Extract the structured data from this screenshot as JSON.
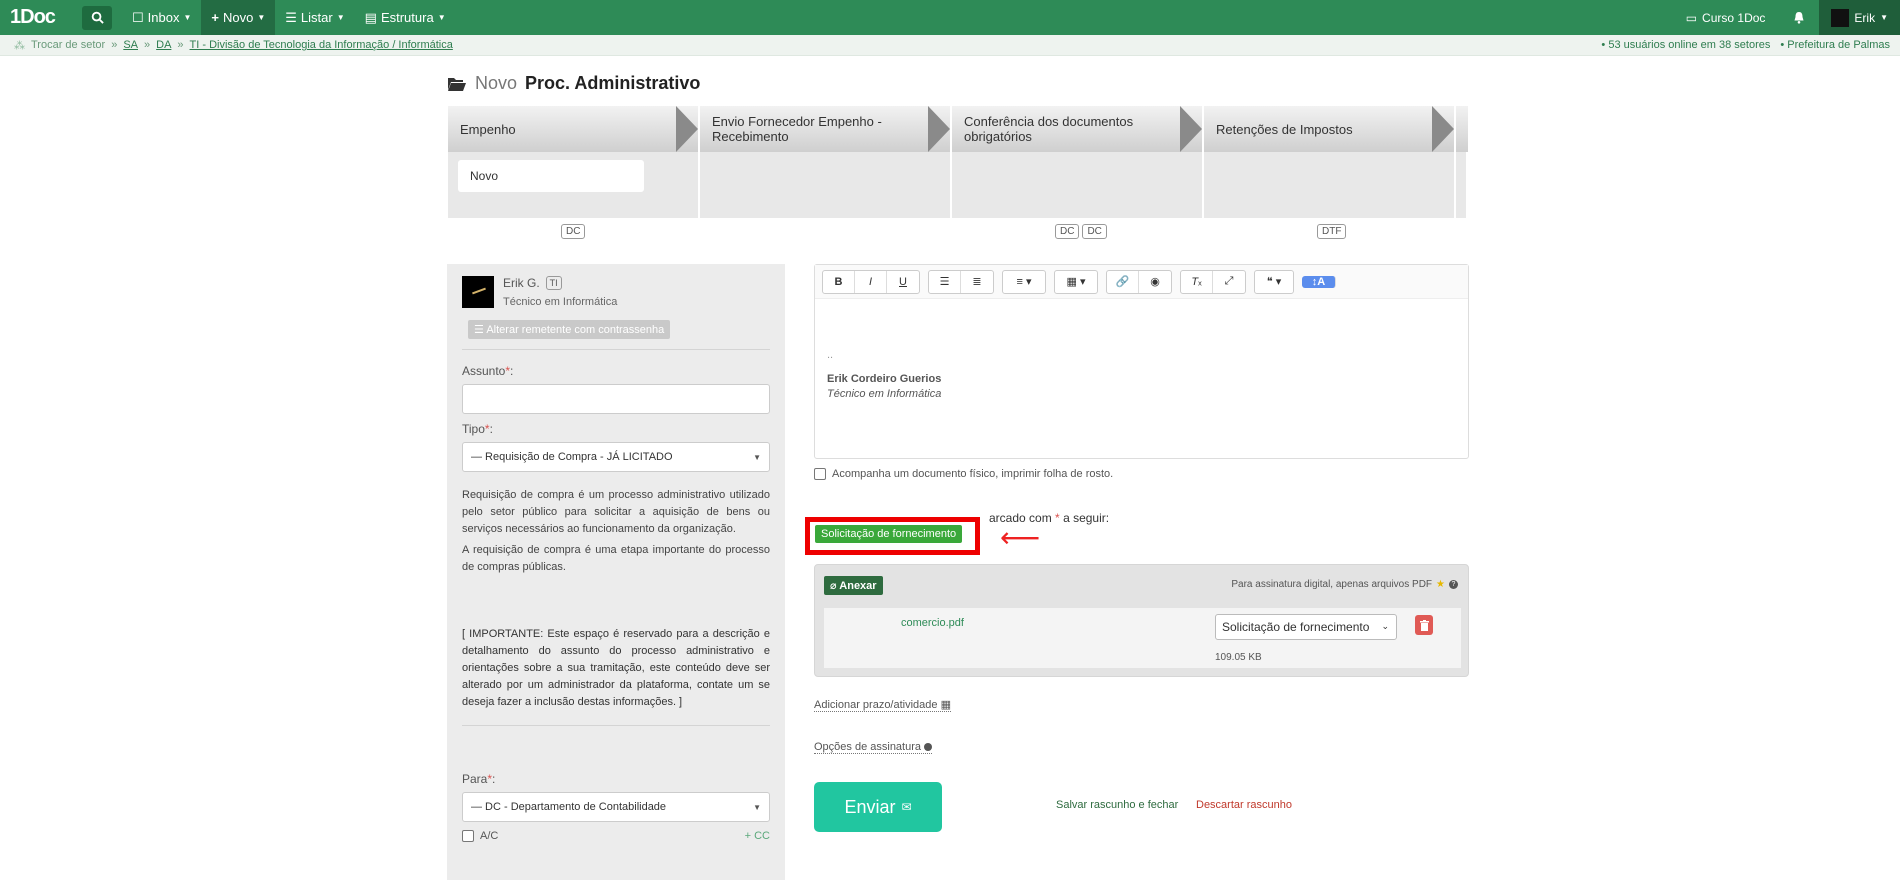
{
  "topbar": {
    "logo": "1Doc",
    "menu": [
      {
        "label": "Inbox",
        "icon": "inbox-icon"
      },
      {
        "label": "Novo",
        "icon": "plus-icon"
      },
      {
        "label": "Listar",
        "icon": "list-icon"
      },
      {
        "label": "Estrutura",
        "icon": "building-icon"
      }
    ],
    "course": "Curso 1Doc",
    "user": "Erik"
  },
  "subbar": {
    "change_sector": "Trocar de setor",
    "breadcrumb": [
      "SA",
      "DA",
      "TI - Divisão de Tecnologia da Informação / Informática"
    ],
    "users_online": "• 53 usuários online em 38 setores",
    "org": "• Prefeitura de Palmas"
  },
  "page": {
    "title_prefix": "Novo",
    "title": "Proc. Administrativo"
  },
  "steps": [
    {
      "label": "Empenho",
      "card": "Novo",
      "badges": [
        "DC"
      ]
    },
    {
      "label": "Envio Fornecedor Empenho - Recebimento",
      "card": "",
      "badges": []
    },
    {
      "label": "Conferência dos documentos obrigatórios",
      "card": "",
      "badges": [
        "DC",
        "DC"
      ]
    },
    {
      "label": "Retenções de Impostos",
      "card": "",
      "badges": [
        "DTF"
      ]
    }
  ],
  "sender": {
    "name": "Erik G.",
    "tag": "TI",
    "role": "Técnico em Informática",
    "alt_button": "Alterar remetente com contrassenha"
  },
  "form": {
    "assunto_label": "Assunto",
    "tipo_label": "Tipo",
    "tipo_value": "— Requisição de Compra - JÁ LICITADO",
    "desc_p1": "Requisição de compra é um processo administrativo utilizado pelo setor público para solicitar a aquisição de bens ou serviços necessários ao funcionamento da organização.",
    "desc_p2": "A requisição de compra é uma etapa importante do processo de compras públicas.",
    "important": "[ IMPORTANTE: Este espaço é reservado para a descrição e detalhamento do assunto do processo administrativo e orientações sobre a sua tramitação, este conteúdo deve ser alterado por um administrador da plataforma, contate um se deseja fazer a inclusão destas informações. ]",
    "para_label": "Para",
    "para_value": "— DC - Departamento de Contabilidade",
    "ac_label": "A/C",
    "cc_label": "+ CC"
  },
  "editor": {
    "dots": "..",
    "signature_name": "Erik Cordeiro Guerios",
    "signature_role": "Técnico em Informática"
  },
  "physical_label": "Acompanha um documento físico, imprimir folha de rosto.",
  "upload": {
    "instruction_end": "arcado com",
    "instruction_tail": "a seguir:",
    "asterisk": "*",
    "required_doc": "Solicitação de fornecimento",
    "attach_label": "Anexar",
    "pdf_note": "Para assinatura digital, apenas arquivos PDF",
    "file_name": "comercio.pdf",
    "file_type": "Solicitação de fornecimento",
    "file_size": "109.05 KB"
  },
  "links": {
    "deadline": "Adicionar prazo/atividade",
    "signature_options": "Opções de assinatura"
  },
  "actions": {
    "send": "Enviar",
    "save_draft": "Salvar rascunho e fechar",
    "discard_draft": "Descartar rascunho"
  },
  "colors": {
    "topbar": "#2e8b57",
    "send": "#21c6a0",
    "highlight": "#ee0000",
    "tag_green": "#3aa83a"
  }
}
